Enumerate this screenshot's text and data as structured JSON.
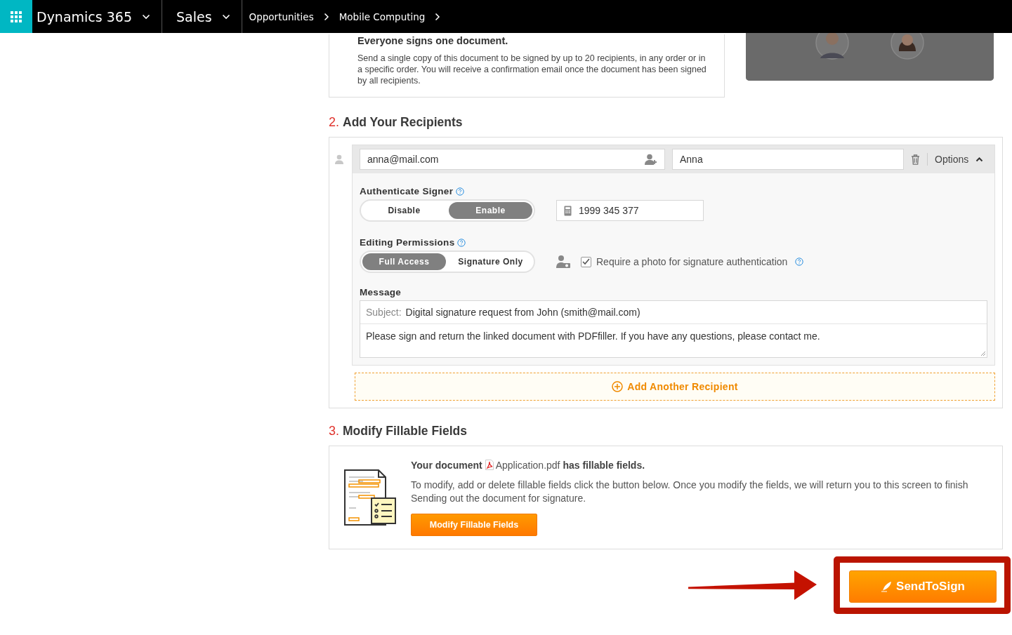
{
  "header": {
    "app": "Dynamics 365",
    "area": "Sales",
    "breadcrumbs": [
      "Opportunities",
      "Mobile Computing"
    ]
  },
  "intro": {
    "title": "Everyone signs one document.",
    "text": "Send a single copy of this document to be signed by up to 20 recipients, in any order or in a specific order. You will receive a confirmation email once the document has been signed by all recipients."
  },
  "recipients_section": {
    "number": "2.",
    "title": "Add Your Recipients"
  },
  "recipient": {
    "email": "anna@mail.com",
    "name": "Anna",
    "options": "Options",
    "expanded": true,
    "authenticate": {
      "label": "Authenticate Signer",
      "options": [
        {
          "label": "Disable",
          "selected": false
        },
        {
          "label": "Enable",
          "selected": true
        }
      ],
      "phone": "1999 345 377"
    },
    "permissions": {
      "label": "Editing Permissions",
      "options": [
        {
          "label": "Full Access",
          "selected": true
        },
        {
          "label": "Signature Only",
          "selected": false
        }
      ],
      "require_photo": {
        "label": "Require a photo for signature authentication",
        "checked": true
      }
    },
    "message": {
      "label": "Message",
      "subject_label": "Subject:",
      "subject": "Digital signature request from John (smith@mail.com)",
      "body": "Please sign and return the linked document with PDFfiller. If you have any questions, please contact me."
    }
  },
  "add_recipient": "Add Another Recipient",
  "fillable_section": {
    "number": "3.",
    "title": "Modify Fillable Fields",
    "doc_prefix": "Your document",
    "file": "Application.pdf",
    "doc_suffix": "has fillable fields.",
    "text": "To modify, add or delete fillable fields click the button below. Once you modify the fields, we will return you to this screen to finish Sending out the document for signature.",
    "button": "Modify Fillable Fields"
  },
  "send_button": "SendToSign"
}
